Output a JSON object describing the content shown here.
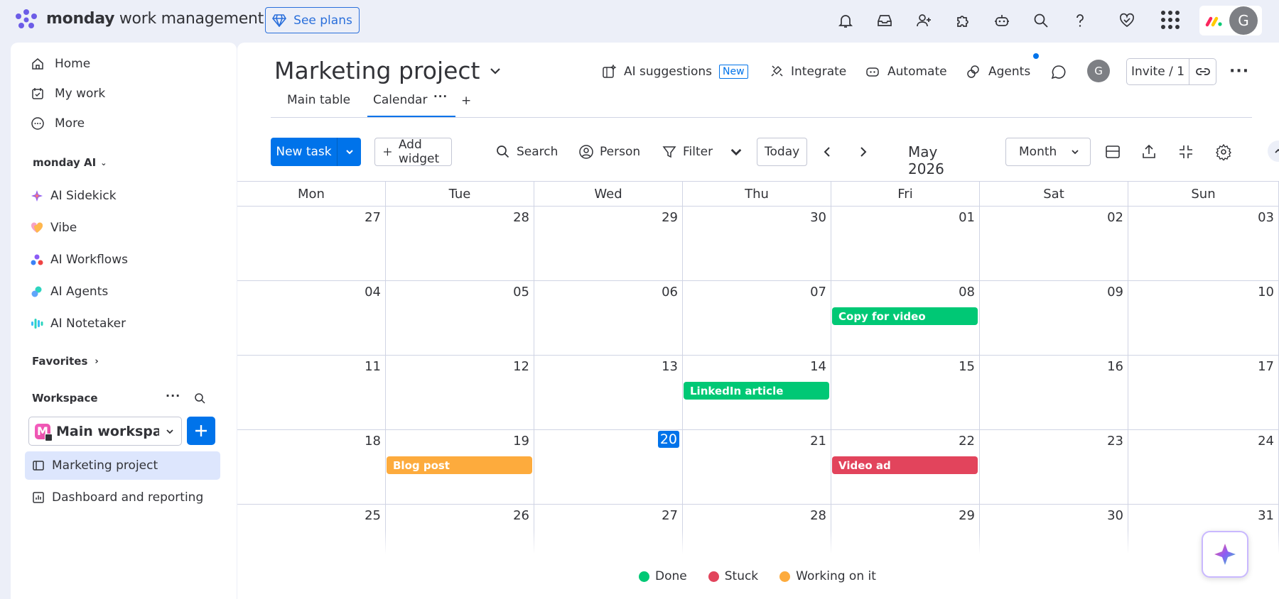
{
  "app": {
    "brand_bold": "monday",
    "brand_rest": " work management",
    "see_plans": "See plans"
  },
  "sidebar": {
    "nav": [
      {
        "label": "Home",
        "icon": "home-icon"
      },
      {
        "label": "My work",
        "icon": "calendar-check-icon"
      },
      {
        "label": "More",
        "icon": "more-circle-icon"
      }
    ],
    "ai_section": "monday AI",
    "ai_items": [
      {
        "label": "AI Sidekick",
        "color": "#8b5cf6"
      },
      {
        "label": "Vibe",
        "color": "#f27eb0"
      },
      {
        "label": "AI Workflows",
        "color": "#3b82f6"
      },
      {
        "label": "AI Agents",
        "color": "#2dd4bf"
      },
      {
        "label": "AI Notetaker",
        "color": "#38bdf8"
      }
    ],
    "favorites": "Favorites",
    "workspace_section": "Workspace",
    "workspace_badge": "M",
    "workspace_name": "Main workspa...",
    "boards": [
      {
        "label": "Marketing project",
        "active": true
      },
      {
        "label": "Dashboard and reporting",
        "active": false
      }
    ]
  },
  "header": {
    "title": "Marketing project",
    "ai_suggestions": "AI suggestions",
    "new_badge": "New",
    "integrate": "Integrate",
    "automate": "Automate",
    "agents": "Agents",
    "avatar_initial": "G",
    "invite": "Invite / 1"
  },
  "tabs": {
    "main_table": "Main table",
    "calendar": "Calendar",
    "add": "+"
  },
  "toolbar": {
    "new_task": "New task",
    "add_widget": "Add widget",
    "search": "Search",
    "person": "Person",
    "filter": "Filter",
    "today": "Today",
    "month_label": "May 2026",
    "view_select": "Month"
  },
  "calendar": {
    "weekdays": [
      "Mon",
      "Tue",
      "Wed",
      "Thu",
      "Fri",
      "Sat",
      "Sun"
    ],
    "weeks": [
      [
        "27",
        "28",
        "29",
        "30",
        "01",
        "02",
        "03"
      ],
      [
        "04",
        "05",
        "06",
        "07",
        "08",
        "09",
        "10"
      ],
      [
        "11",
        "12",
        "13",
        "14",
        "15",
        "16",
        "17"
      ],
      [
        "18",
        "19",
        "20",
        "21",
        "22",
        "23",
        "24"
      ],
      [
        "25",
        "26",
        "27",
        "28",
        "29",
        "30",
        "31"
      ]
    ],
    "today": {
      "week": 3,
      "day": 2
    },
    "events": [
      {
        "title": "Copy for video",
        "week": 1,
        "day": 4,
        "status": "Done"
      },
      {
        "title": "LinkedIn article",
        "week": 2,
        "day": 3,
        "status": "Done"
      },
      {
        "title": "Blog post",
        "week": 3,
        "day": 1,
        "status": "Working on it"
      },
      {
        "title": "Video ad",
        "week": 3,
        "day": 4,
        "status": "Stuck"
      }
    ]
  },
  "legend": [
    {
      "label": "Done",
      "color": "#00c875"
    },
    {
      "label": "Stuck",
      "color": "#e2445c"
    },
    {
      "label": "Working on it",
      "color": "#fdab3d"
    }
  ],
  "colors": {
    "primary": "#0073ea",
    "done": "#00c875",
    "stuck": "#e2445c",
    "working": "#fdab3d"
  }
}
